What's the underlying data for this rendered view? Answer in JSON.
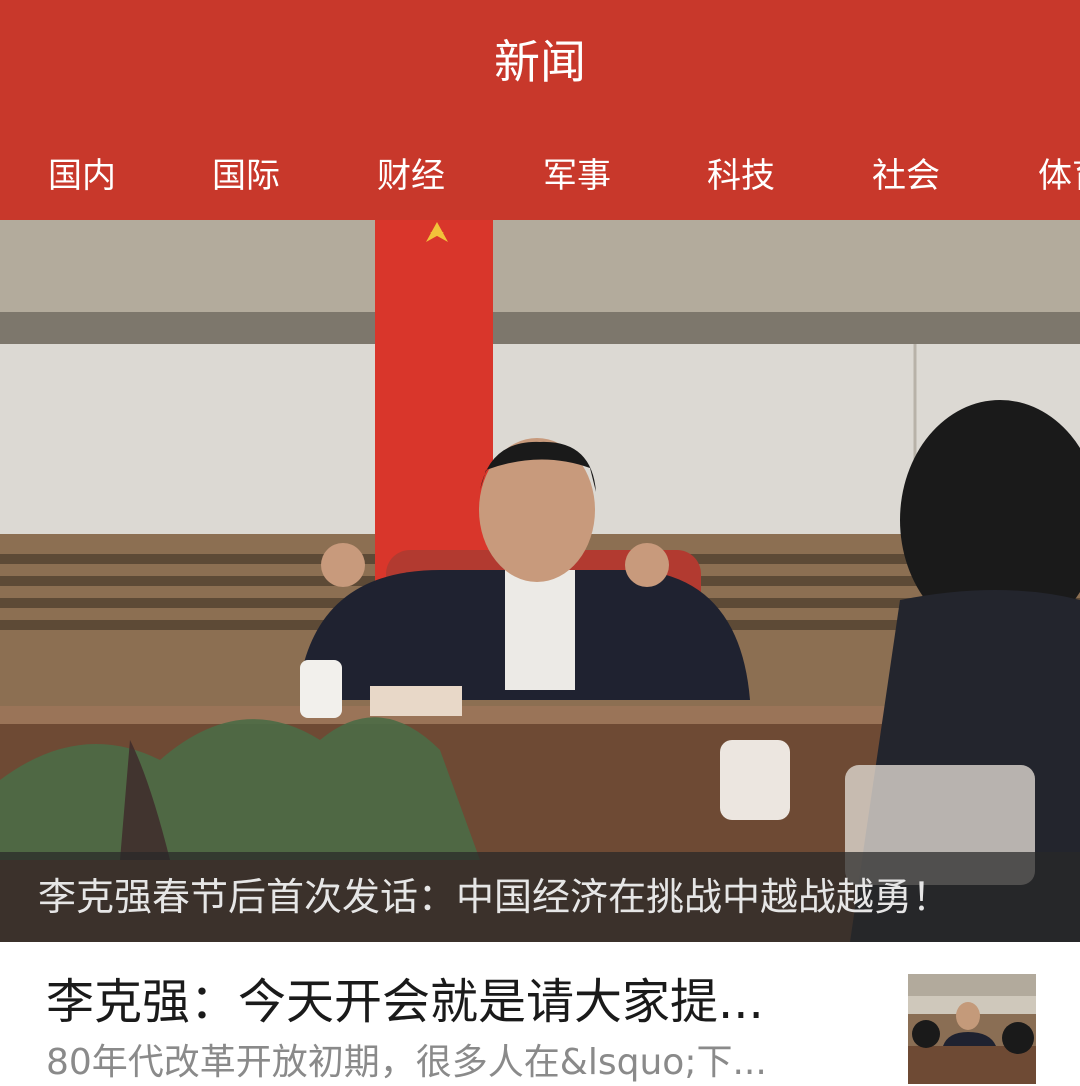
{
  "header": {
    "title": "新闻",
    "tabs": [
      "国内",
      "国际",
      "财经",
      "军事",
      "科技",
      "社会",
      "体育"
    ]
  },
  "hero": {
    "caption": "李克强春节后首次发话：中国经济在挑战中越战越勇！"
  },
  "list": [
    {
      "title": "李克强：今天开会就是请大家提...",
      "summary": "80年代改革开放初期，很多人在&lsquo;下..."
    }
  ],
  "colors": {
    "header_bg": "#c8382b",
    "caption_bg": "#282828",
    "title_text": "#1a1a1a",
    "summary_text": "#8a8a8a"
  }
}
